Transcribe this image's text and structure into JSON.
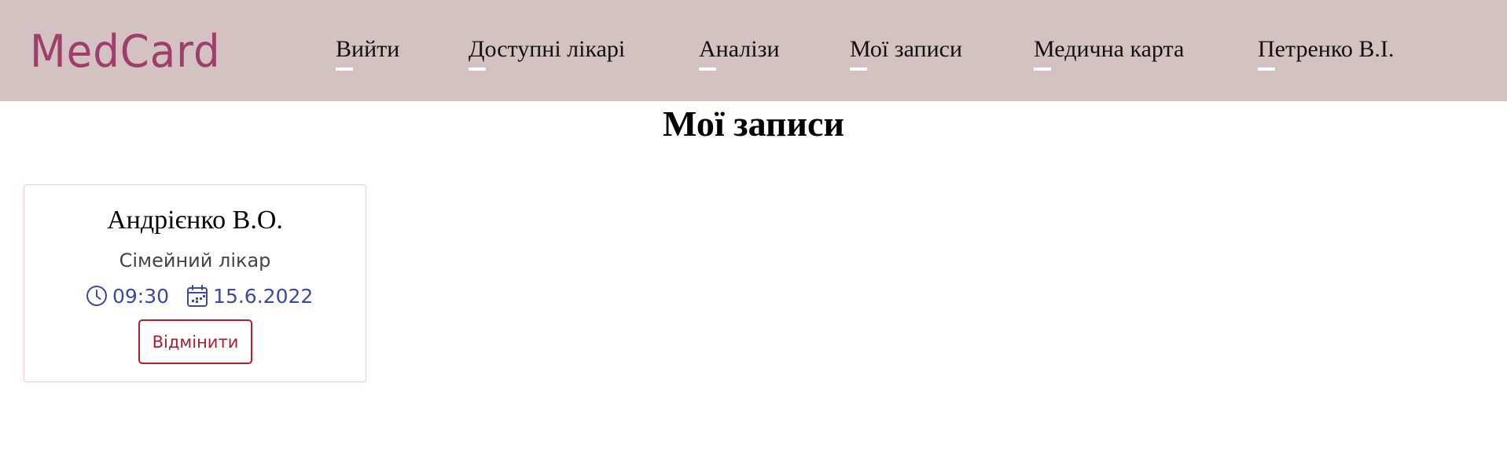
{
  "header": {
    "logo": "MedCard",
    "nav": [
      {
        "label": "Вийти"
      },
      {
        "label": "Доступні лікарі"
      },
      {
        "label": "Аналізи"
      },
      {
        "label": "Мої записи"
      },
      {
        "label": "Медична карта"
      },
      {
        "label": "Петренко В.І."
      }
    ]
  },
  "main": {
    "title": "Мої записи",
    "appointments": [
      {
        "doctor": "Андрієнко В.О.",
        "specialty": "Сімейний лікар",
        "time": "09:30",
        "date": "15.6.2022",
        "time_icon": "clock-icon",
        "date_icon": "calendar-icon",
        "cancel_label": "Відмінити"
      }
    ]
  },
  "colors": {
    "header_bg": "#d4c1c1",
    "logo": "#9e3f6b",
    "meta_text": "#3c4a99",
    "cancel": "#b21f2d",
    "card_border": "#f0c8c8"
  }
}
